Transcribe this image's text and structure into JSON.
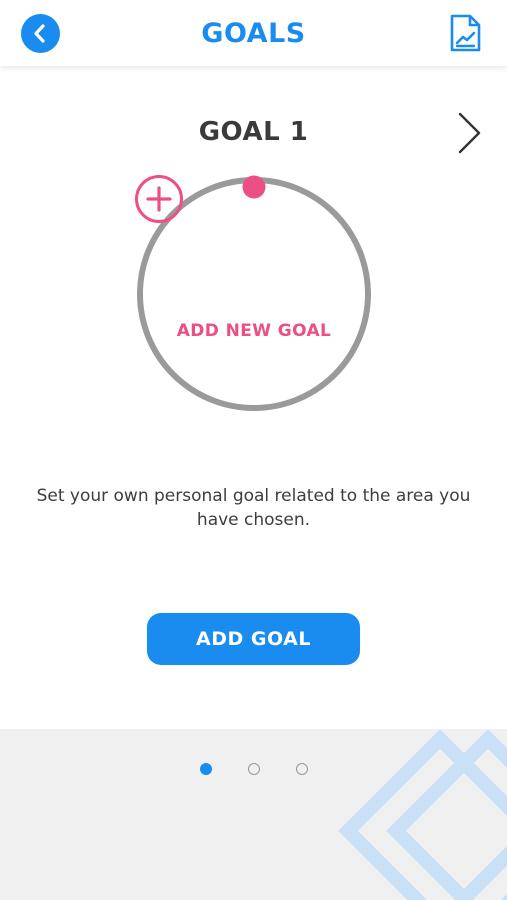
{
  "header": {
    "title": "GOALS",
    "back_icon": "chevron-left-icon",
    "report_icon": "report-chart-icon"
  },
  "goal_nav": {
    "label": "GOAL 1",
    "next_icon": "chevron-right-icon"
  },
  "ring": {
    "label": "ADD NEW GOAL",
    "icon": "plus-circle-icon"
  },
  "description": "Set your own personal goal related to the area you have chosen.",
  "add_goal_button": "ADD GOAL",
  "pagination": {
    "total": 3,
    "active_index": 0
  },
  "colors": {
    "primary": "#1a8cf0",
    "accent": "#ec4f86",
    "ring": "#9a9a9a",
    "bottom_background": "#f0f0f0"
  }
}
